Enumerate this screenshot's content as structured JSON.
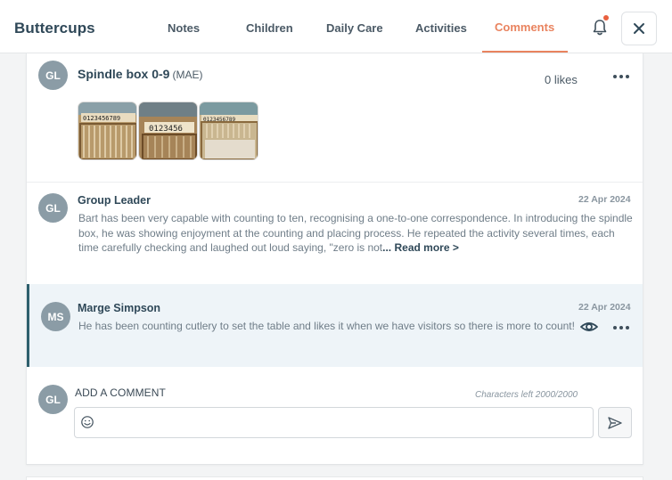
{
  "app": {
    "title": "Buttercups"
  },
  "nav": {
    "tabs": [
      {
        "label": "Notes"
      },
      {
        "label": "Children"
      },
      {
        "label": "Daily Care"
      },
      {
        "label": "Activities"
      },
      {
        "label": "Comments",
        "active": true
      }
    ]
  },
  "icons": {
    "bell": "bell-icon",
    "close": "close-icon",
    "more": "more-dots-icon",
    "eye": "eye-icon",
    "smile": "emoji-icon",
    "send": "send-icon"
  },
  "colors": {
    "accent": "#e9835f",
    "brand": "#2f4858",
    "avatar": "#8b9ca6",
    "highlight": "#eef4f8",
    "highlight_border": "#2e5f6c"
  },
  "post": {
    "avatar_initials": "GL",
    "title": "Spindle box 0-9",
    "tag": "(MAE)",
    "likes": "0 likes",
    "photos": [
      "spindle-box-photo-1",
      "spindle-box-photo-2",
      "spindle-box-photo-3"
    ]
  },
  "comments": [
    {
      "avatar_initials": "GL",
      "author": "Group Leader",
      "date": "22 Apr 2024",
      "text": "Bart has been very capable with counting to ten, recognising a one-to-one correspondence. In introducing the spindle box, he was showing enjoyment at the counting and placing process. He repeated the activity several times, each time carefully checking and laughed out loud saying, \"zero is not",
      "read_more": "... Read more >"
    },
    {
      "avatar_initials": "MS",
      "author": "Marge Simpson",
      "date": "22 Apr 2024",
      "text": "He has been counting cutlery to set the table and likes it when we have visitors so there is more to count!"
    }
  ],
  "add_comment": {
    "avatar_initials": "GL",
    "label": "ADD A COMMENT",
    "chars_left": "Characters left 2000/2000",
    "value": "",
    "placeholder": ""
  }
}
